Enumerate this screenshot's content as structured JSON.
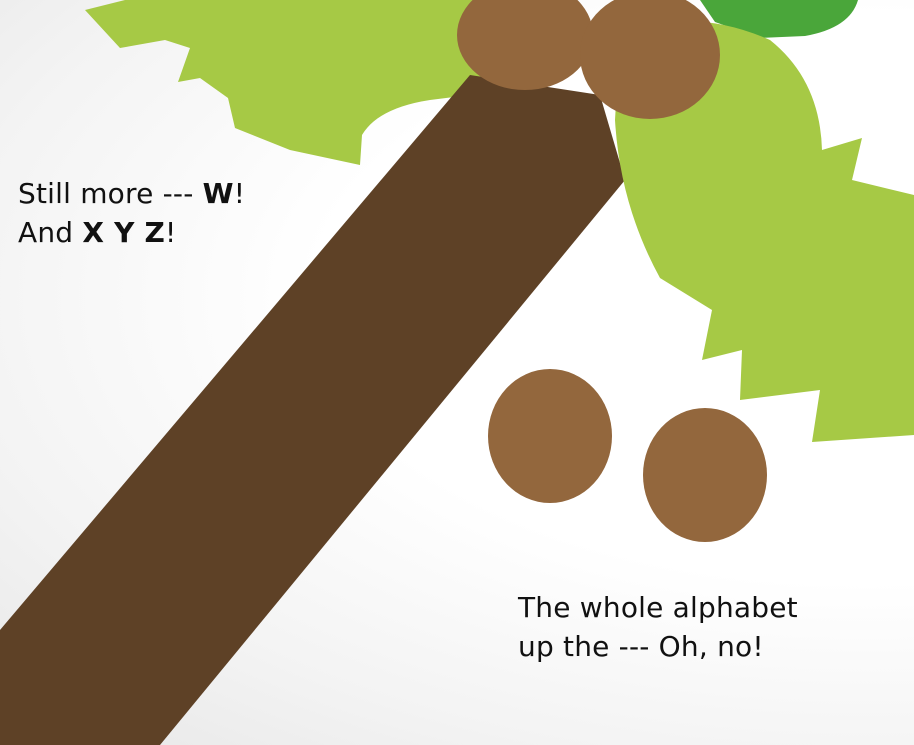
{
  "colors": {
    "trunk": "#5e4126",
    "coconut": "#93673d",
    "leaf_light": "#a6c945",
    "leaf_mid": "#8cc043",
    "leaf_dark": "#4aa63a",
    "text": "#111111"
  },
  "page": {
    "verse_1": {
      "line_1_prefix": "Still more --- ",
      "line_1_bold": "W",
      "line_1_suffix": "!",
      "line_2_prefix": "And ",
      "line_2_bold": "X Y Z",
      "line_2_suffix": "!"
    },
    "verse_2": {
      "line_1": "The whole alphabet",
      "line_2": "up the --- Oh, no!"
    }
  }
}
